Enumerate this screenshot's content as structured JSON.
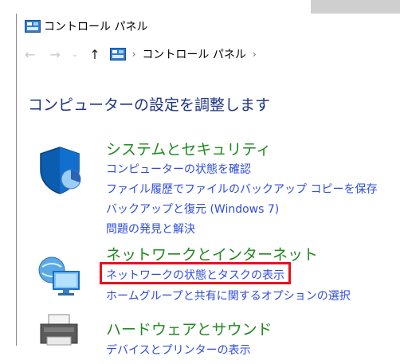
{
  "window": {
    "title": "コントロール パネル"
  },
  "nav": {
    "back": "←",
    "forward": "→",
    "recent": "⌄",
    "up": "↑",
    "chevron": "›",
    "breadcrumb": "コントロール パネル"
  },
  "page_title": "コンピューターの設定を調整します",
  "categories": [
    {
      "heading": "システムとセキュリティ",
      "icon": "shield-icon",
      "links": [
        "コンピューターの状態を確認",
        "ファイル履歴でファイルのバックアップ コピーを保存",
        "バックアップと復元 (Windows 7)",
        "問題の発見と解決"
      ]
    },
    {
      "heading": "ネットワークとインターネット",
      "icon": "network-icon",
      "links": [
        "ネットワークの状態とタスクの表示",
        "ホームグループと共有に関するオプションの選択"
      ]
    },
    {
      "heading": "ハードウェアとサウンド",
      "icon": "printer-icon",
      "links": [
        "デバイスとプリンターの表示"
      ]
    }
  ],
  "colors": {
    "heading_green": "#1f8a1f",
    "link_blue": "#2d4ce0",
    "title_blue": "#1e3287",
    "highlight_red": "#e8111b"
  }
}
